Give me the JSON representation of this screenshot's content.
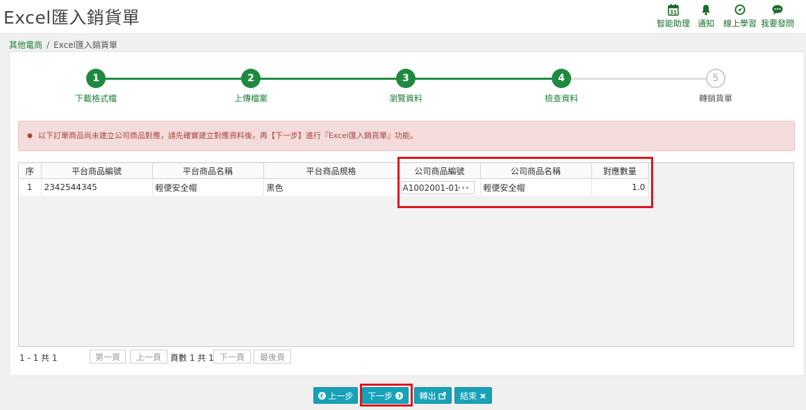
{
  "page": {
    "title": "Excel匯入銷貨單"
  },
  "tools": [
    {
      "label": "智能助理",
      "icon": "calendar-31-icon",
      "badge": "31"
    },
    {
      "label": "通知",
      "icon": "bell-icon"
    },
    {
      "label": "線上學習",
      "icon": "compass-icon"
    },
    {
      "label": "我要發問",
      "icon": "chat-bubble-icon"
    }
  ],
  "breadcrumb": {
    "parent": "其他電商",
    "current": "Excel匯入銷貨單",
    "separator": "/"
  },
  "steps": [
    {
      "number": "1",
      "label": "下載格式檔",
      "active": true
    },
    {
      "number": "2",
      "label": "上傳檔案",
      "active": true
    },
    {
      "number": "3",
      "label": "瀏覽資料",
      "active": true
    },
    {
      "number": "4",
      "label": "檢查資料",
      "active": true
    },
    {
      "number": "5",
      "label": "轉銷貨單",
      "active": false
    }
  ],
  "alert": {
    "message": "以下訂單商品尚未建立公司商品對應，請先確實建立對應資料後，再【下一步】進行『Excel匯入銷貨單』功能。"
  },
  "grid": {
    "headers": [
      "序",
      "平台商品編號",
      "平台商品名稱",
      "平台商品規格",
      "公司商品編號",
      "公司商品名稱",
      "對應數量"
    ],
    "rows": [
      {
        "seq": "1",
        "platform_code": "2342544345",
        "platform_name": "輕便安全帽",
        "platform_spec": "黑色",
        "company_code": "A1002001-01",
        "company_name": "輕便安全帽",
        "qty": "1.0"
      }
    ]
  },
  "pager": {
    "summary": "1 - 1 共 1",
    "first": "第一頁",
    "prev": "上一頁",
    "page_info": "頁數 1 共 1",
    "next": "下一頁",
    "last": "最後頁"
  },
  "actions": {
    "prev": "上一步",
    "next": "下一步",
    "export": "轉出",
    "finish": "結束"
  },
  "colors": {
    "brand_green": "#1f8a3f",
    "alert_text": "#a94442",
    "button_teal": "#17a2b8",
    "highlight_red": "#e0151c"
  }
}
